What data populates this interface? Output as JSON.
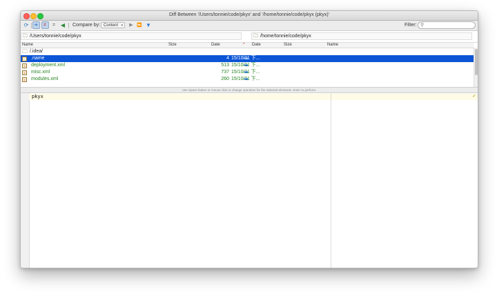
{
  "window": {
    "title": "Diff Between '/Users/tonnie/code/pkyx' and '/home/tonnie/code/pkyx (pkyx)'"
  },
  "toolbar": {
    "compare_by_label": "Compare by:",
    "compare_by_value": "Content",
    "filter_label": "Filter:",
    "filter_placeholder": ""
  },
  "paths": {
    "left": "/Users/tonnie/code/pkyx",
    "right": "/home/tonnie/code/pkyx"
  },
  "columns": {
    "left_name": "Name",
    "left_size": "Size",
    "left_date": "Date",
    "sort_marker": "*",
    "right_date": "Date",
    "right_size": "Size",
    "right_name": "Name"
  },
  "rows": [
    {
      "name": "/.idea/",
      "size": "",
      "date": "",
      "kind": "folder"
    },
    {
      "name": ".name",
      "size": "4",
      "date": "15/10/11 下...",
      "kind": "file",
      "selected": true
    },
    {
      "name": "deployment.xml",
      "size": "513",
      "date": "15/10/11 下...",
      "kind": "file"
    },
    {
      "name": "misc.xml",
      "size": "737",
      "date": "15/10/11 下...",
      "kind": "file"
    },
    {
      "name": "modules.xml",
      "size": "260",
      "date": "15/10/11 下...",
      "kind": "file"
    }
  ],
  "status_hint": "Use Space button or mouse click to change operation for the selected elements. Enter to perform.",
  "diff": {
    "left_first_line": "pkyx",
    "right_first_line": ""
  },
  "colors": {
    "selection": "#0b55d6",
    "added_text": "#25831f",
    "arrow": "#2f7bd6"
  }
}
